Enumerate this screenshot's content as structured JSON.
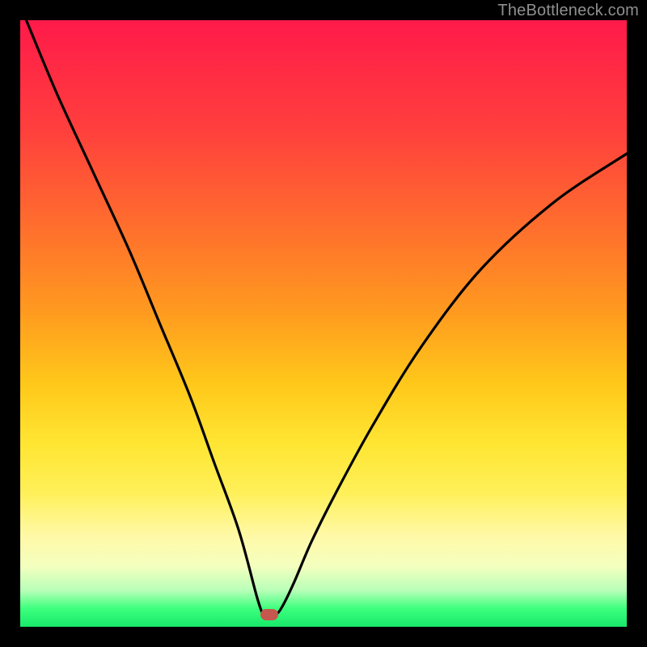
{
  "watermark": "TheBottleneck.com",
  "colors": {
    "frame": "#000000",
    "curve": "#000000",
    "marker": "#c6574e",
    "gradient_stops": [
      {
        "pos": 0.0,
        "hex": "#ff1a4a"
      },
      {
        "pos": 0.18,
        "hex": "#ff3f3d"
      },
      {
        "pos": 0.34,
        "hex": "#ff6e2d"
      },
      {
        "pos": 0.48,
        "hex": "#ff9a1f"
      },
      {
        "pos": 0.6,
        "hex": "#ffc81a"
      },
      {
        "pos": 0.7,
        "hex": "#ffe633"
      },
      {
        "pos": 0.78,
        "hex": "#fff05a"
      },
      {
        "pos": 0.85,
        "hex": "#fff9a7"
      },
      {
        "pos": 0.9,
        "hex": "#f4ffbf"
      },
      {
        "pos": 0.94,
        "hex": "#b8ffb8"
      },
      {
        "pos": 0.97,
        "hex": "#3dff7d"
      },
      {
        "pos": 1.0,
        "hex": "#17e86a"
      }
    ]
  },
  "chart_data": {
    "type": "line",
    "title": "",
    "xlabel": "",
    "ylabel": "",
    "xlim": [
      0,
      100
    ],
    "ylim": [
      0,
      100
    ],
    "series": [
      {
        "name": "bottleneck-curve",
        "x": [
          1,
          6,
          12,
          18,
          23,
          28,
          32,
          36,
          39,
          40,
          41,
          42,
          43,
          45,
          48,
          52,
          58,
          66,
          76,
          88,
          100
        ],
        "y": [
          100,
          88,
          75,
          62,
          50,
          38,
          27,
          16,
          5,
          2,
          2,
          2,
          3,
          7,
          14,
          22,
          33,
          46,
          59,
          70,
          78
        ]
      }
    ],
    "marker": {
      "x": 41,
      "y": 2
    },
    "note": "Values estimated from pixel positions on a 0–100 normalized grid; curve descends steeply from top-left to a cusp near x≈41 on the baseline, then rises with decreasing slope toward the right edge at ~78% height."
  }
}
